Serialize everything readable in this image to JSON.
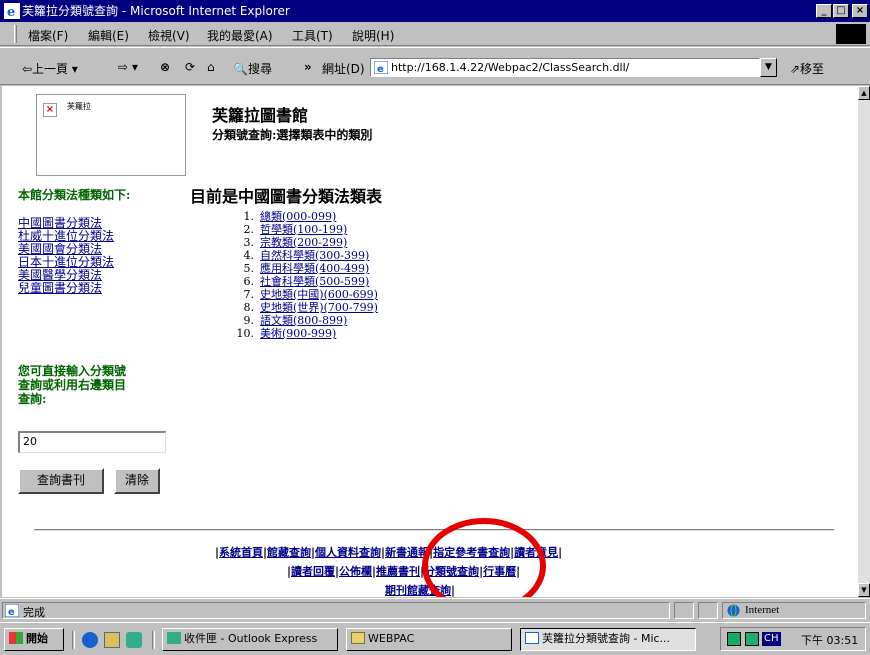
{
  "window": {
    "title": "芙籮拉分類號查詢 - Microsoft Internet Explorer",
    "min": "_",
    "max": "□",
    "close": "×"
  },
  "menu": [
    "檔案(F)",
    "編輯(E)",
    "檢視(V)",
    "我的最愛(A)",
    "工具(T)",
    "說明(H)"
  ],
  "toolbar": {
    "back": "⇦上一頁 ▾",
    "forward": "⇨ ▾",
    "stop": "⊗",
    "refresh": "⟳",
    "home": "⌂",
    "search": "🔍搜尋",
    "more": "»",
    "address_label": "網址(D)",
    "address_value": "http://168.1.4.22/Webpac2/ClassSearch.dll/",
    "go": "⇗移至"
  },
  "page": {
    "logo_alt": "芙籮拉",
    "library_name": "芙籮拉圖書館",
    "subtitle": "分類號查詢:選擇類表中的類別",
    "systems_heading": "本館分類法種類如下:",
    "systems": [
      "中國圖書分類法",
      "杜威十進位分類法",
      "美國國會分類法",
      "日本十進位分類法",
      "美國醫學分類法",
      "兒童圖書分類法"
    ],
    "main_title": "目前是中國圖書分類法類表",
    "classes": [
      {
        "num": "1.",
        "label": "總類(000-099)"
      },
      {
        "num": "2.",
        "label": "哲學類(100-199)"
      },
      {
        "num": "3.",
        "label": "宗教類(200-299)"
      },
      {
        "num": "4.",
        "label": "自然科學類(300-399)"
      },
      {
        "num": "5.",
        "label": "應用科學類(400-499)"
      },
      {
        "num": "6.",
        "label": "社會科學類(500-599)"
      },
      {
        "num": "7.",
        "label": "史地類(中國)(600-699)"
      },
      {
        "num": "8.",
        "label": "史地類(世界)(700-799)"
      },
      {
        "num": "9.",
        "label": "語文類(800-899)"
      },
      {
        "num": "10.",
        "label": "美術(900-999)"
      }
    ],
    "hint_lines": [
      "您可直接輸入分類號",
      "查詢或利用右邊類目",
      "查詢:"
    ],
    "input_value": "20",
    "query_button": "查詢書刊",
    "clear_button": "清除",
    "footer_row1": [
      "系統首頁",
      "館藏查詢",
      "個人資料查詢",
      "新書通報",
      "指定參考書查詢",
      "讀者意見"
    ],
    "footer_row2": [
      "讀者回覆",
      "公佈欄",
      "推薦書刊",
      "分類號查詢",
      "行事曆"
    ],
    "footer_row3": [
      "期刊館藏查詢"
    ],
    "separator": "|"
  },
  "status": {
    "text": "完成",
    "zone": "Internet"
  },
  "taskbar": {
    "start": "開始",
    "tasks": [
      "收件匣 - Outlook Express",
      "WEBPAC",
      "芙籮拉分類號查詢 - Mic..."
    ],
    "tray_time": "下午 03:51",
    "tray_ime": "CH"
  },
  "colors": {
    "title_bar": "#000080",
    "link": "#00008b",
    "heading_green": "#006400",
    "annotation_circle": "#e60000"
  }
}
